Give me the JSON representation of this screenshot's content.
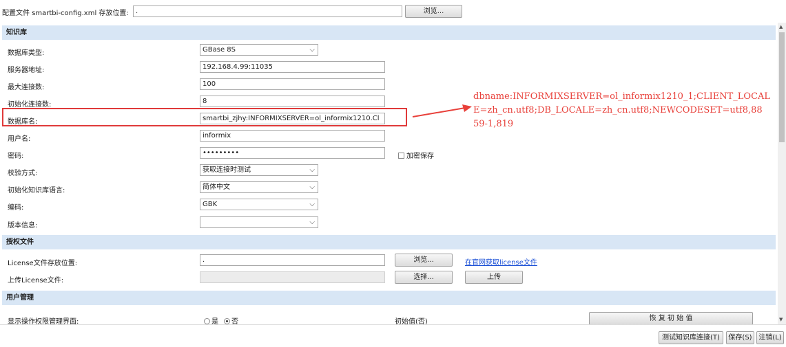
{
  "top": {
    "label": "配置文件 smartbi-config.xml 存放位置:",
    "path_value": ".",
    "browse": "浏览..."
  },
  "sections": {
    "kb": "知识库",
    "license": "授权文件",
    "users": "用户管理"
  },
  "kb": {
    "db_type_label": "数据库类型:",
    "db_type_value": "GBase 8S",
    "server_label": "服务器地址:",
    "server_value": "192.168.4.99:11035",
    "maxconn_label": "最大连接数:",
    "maxconn_value": "100",
    "initconn_label": "初始化连接数:",
    "initconn_value": "8",
    "dbname_label": "数据库名:",
    "dbname_value": "smartbi_zjhy:INFORMIXSERVER=ol_informix1210.Cl",
    "user_label": "用户名:",
    "user_value": "informix",
    "pwd_label": "密码:",
    "pwd_value": "•••••••••",
    "encrypt_label": "加密保存",
    "verify_label": "校验方式:",
    "verify_value": "获取连接时测试",
    "lang_label": "初始化知识库语言:",
    "lang_value": "简体中文",
    "enc_label": "编码:",
    "enc_value": "GBK",
    "ver_label": "版本信息:",
    "ver_value": ""
  },
  "license": {
    "path_label": "License文件存放位置:",
    "path_value": ".",
    "browse": "浏览...",
    "get_link": "在官网获取license文件",
    "upload_label": "上传License文件:",
    "upload_value": "",
    "choose": "选择...",
    "upload": "上传"
  },
  "users": {
    "show_label": "显示操作权限管理界面:",
    "yes": "是",
    "no": "否",
    "init_value": "初始值(否)",
    "restore": "恢 复 初 始 值"
  },
  "annotation": {
    "line1": "dbname:INFORMIXSERVER=ol_informix1210_1;CLIENT_LOCAL",
    "line2": "E=zh_cn.utf8;DB_LOCALE=zh_cn.utf8;NEWCODESET=utf8,88",
    "line3": "59-1,819"
  },
  "footer": {
    "test": "测试知识库连接(T)",
    "save": "保存(S)",
    "logout": "注销(L)"
  },
  "colors": {
    "section_bg": "#d8e6f5",
    "highlight": "#e03a3a",
    "annotation": "#e8403a"
  }
}
